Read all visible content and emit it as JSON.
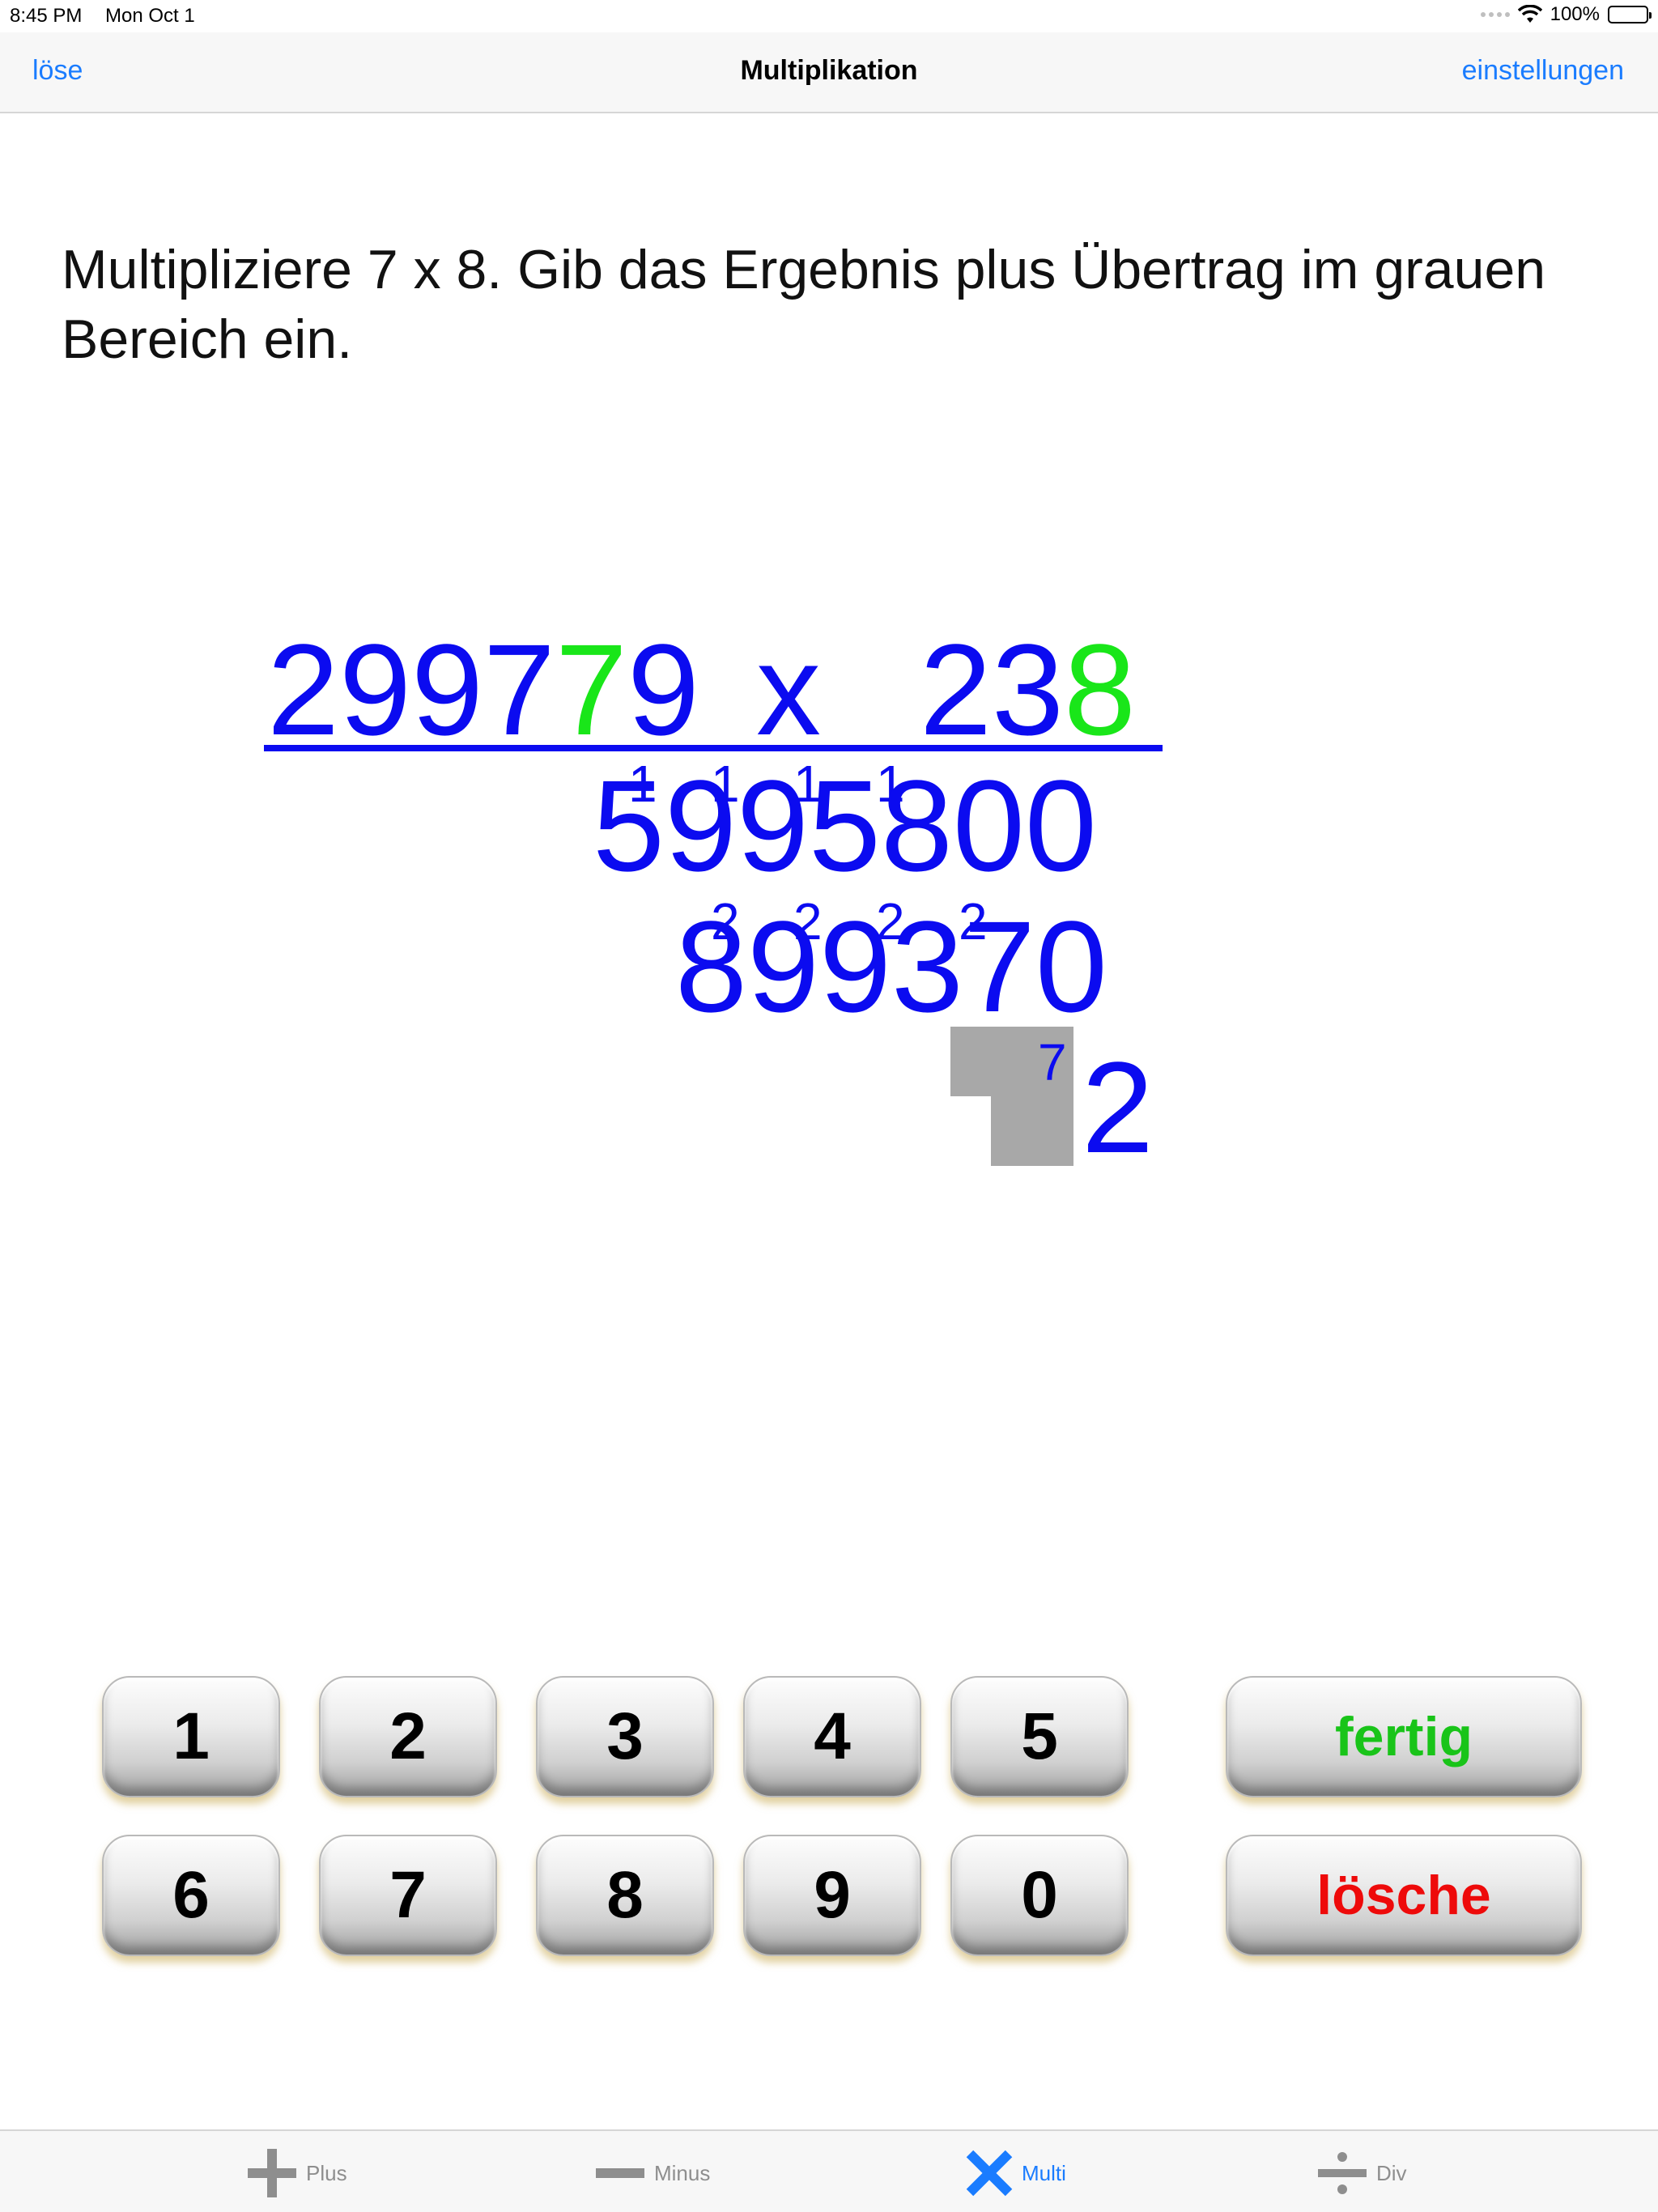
{
  "status_bar": {
    "time": "8:45 PM",
    "date": "Mon Oct 1",
    "battery": "100%"
  },
  "nav": {
    "left": "löse",
    "title": "Multiplikation",
    "right": "einstellungen"
  },
  "instruction": "Multipliziere 7 x 8.  Gib das Ergebnis plus Übertrag im grauen Bereich ein.",
  "problem": {
    "multiplicand": {
      "a": "2997",
      "highlight": "7",
      "b": "9"
    },
    "operator": "x",
    "multiplier": {
      "a": "23",
      "highlight": "8"
    },
    "partial_1": "5995800",
    "carries_1": [
      "1",
      "1",
      "1",
      "1"
    ],
    "partial_2": "899370",
    "carries_2": [
      "2",
      "2",
      "2",
      "2"
    ],
    "partial_3_carry": "7",
    "partial_3": "2"
  },
  "keypad": {
    "keys": [
      "1",
      "2",
      "3",
      "4",
      "5",
      "6",
      "7",
      "8",
      "9",
      "0"
    ],
    "done": "fertig",
    "clear": "lösche"
  },
  "tabs": [
    {
      "label": "Plus",
      "icon": "plus-icon"
    },
    {
      "label": "Minus",
      "icon": "minus-icon"
    },
    {
      "label": "Multi",
      "icon": "multiply-icon",
      "active": true
    },
    {
      "label": "Div",
      "icon": "divide-icon"
    }
  ],
  "colors": {
    "accent": "#1a7cff",
    "problem_digits": "#0b0bf0",
    "highlight": "#19e619",
    "done": "#19c419",
    "clear": "#ee0a0a",
    "input_box": "#a8a8a8"
  }
}
